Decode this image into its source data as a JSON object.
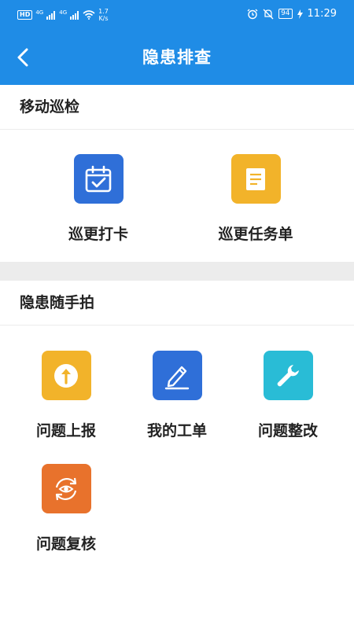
{
  "status_bar": {
    "hd_label": "HD",
    "network_1": "4G",
    "network_2": "4G",
    "speed_value": "1.7",
    "speed_unit": "K/s",
    "battery": "94",
    "time": "11:29",
    "icons": [
      "alarm-icon",
      "mute-icon",
      "battery-icon",
      "charging-icon",
      "wifi-icon",
      "signal-icon"
    ]
  },
  "navbar": {
    "title": "隐患排查",
    "back_icon": "chevron-left-icon"
  },
  "sections": [
    {
      "title": "移动巡检",
      "items": [
        {
          "label": "巡更打卡",
          "icon": "calendar-check-icon",
          "color": "#2f6fd8"
        },
        {
          "label": "巡更任务单",
          "icon": "document-list-icon",
          "color": "#f2b32a"
        }
      ]
    },
    {
      "title": "隐患随手拍",
      "items": [
        {
          "label": "问题上报",
          "icon": "upload-arrow-icon",
          "color": "#f2b32a"
        },
        {
          "label": "我的工单",
          "icon": "pen-edit-icon",
          "color": "#2f6fd8"
        },
        {
          "label": "问题整改",
          "icon": "wrench-icon",
          "color": "#29bcd6"
        },
        {
          "label": "问题复核",
          "icon": "eye-review-icon",
          "color": "#e8722c"
        }
      ]
    }
  ],
  "colors": {
    "primary": "#1f8ce6",
    "divider": "#ececec"
  }
}
